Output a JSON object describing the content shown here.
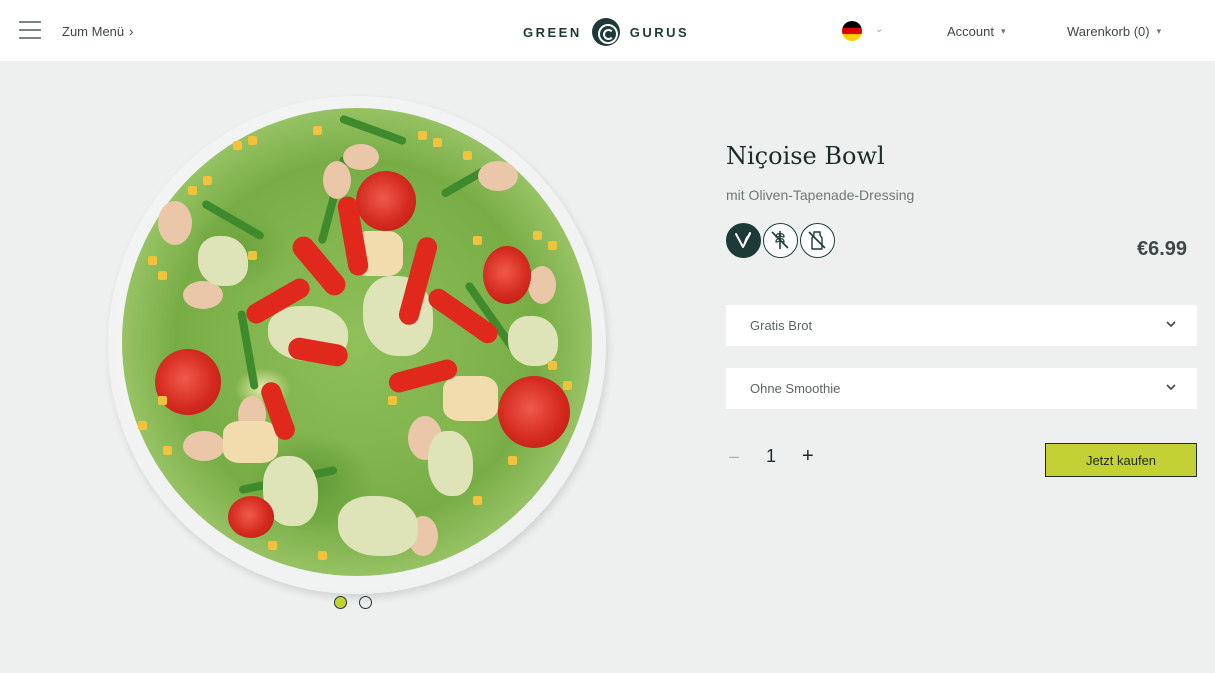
{
  "header": {
    "menu_link": "Zum Menü",
    "logo_left": "GREEN",
    "logo_right": "GURUS",
    "account": "Account",
    "cart": "Warenkorb (0)"
  },
  "product": {
    "title": "Niçoise Bowl",
    "subtitle": "mit Oliven-Tapenade-Dressing",
    "price": "€6.99",
    "badges": [
      "vegan-icon",
      "no-gluten-icon",
      "no-lactose-icon"
    ],
    "options": [
      {
        "label": "Gratis Brot"
      },
      {
        "label": "Ohne Smoothie"
      }
    ],
    "quantity": "1",
    "buy_label": "Jetzt kaufen"
  },
  "carousel": {
    "slides": 2,
    "active": 0
  },
  "colors": {
    "accent": "#c3d135",
    "brand": "#1d3a38",
    "background": "#eef0f0"
  },
  "flag": [
    "#000000",
    "#dd0000",
    "#ffce00"
  ]
}
